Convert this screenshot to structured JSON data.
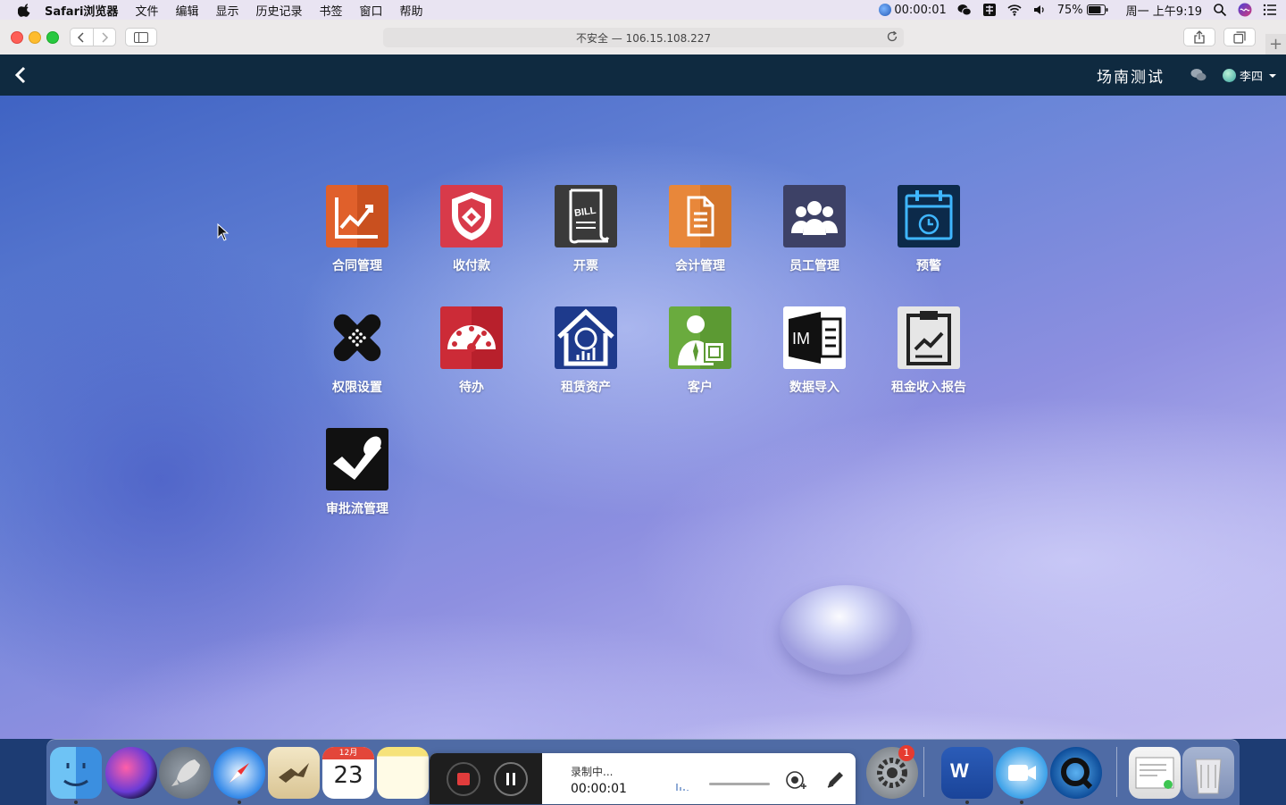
{
  "menubar": {
    "app_name": "Safari浏览器",
    "items": [
      "文件",
      "编辑",
      "显示",
      "历史记录",
      "书签",
      "窗口",
      "帮助"
    ],
    "record_time": "00:00:01",
    "battery": "75%",
    "datetime": "周一 上午9:19"
  },
  "browser": {
    "address": "不安全 — 106.15.108.227"
  },
  "app": {
    "title": "场南测试",
    "user_name": "李四"
  },
  "tiles": [
    {
      "label": "合同管理",
      "icon": "contract-chart-icon",
      "color": "#e0602b"
    },
    {
      "label": "收付款",
      "icon": "payment-shield-icon",
      "color": "#d83a4a"
    },
    {
      "label": "开票",
      "icon": "bill-receipt-icon",
      "color": "#3a3a3a"
    },
    {
      "label": "会计管理",
      "icon": "accounting-document-icon",
      "color": "#e8873a"
    },
    {
      "label": "员工管理",
      "icon": "staff-group-icon",
      "color": "#3d4166"
    },
    {
      "label": "预警",
      "icon": "alarm-calendar-icon",
      "color": "#0c2a4a"
    },
    {
      "label": "权限设置",
      "icon": "permission-bandage-icon",
      "color": "#111111"
    },
    {
      "label": "待办",
      "icon": "todo-gauge-icon",
      "color": "#cc2b37"
    },
    {
      "label": "租赁资产",
      "icon": "lease-house-icon",
      "color": "#1e3a8c"
    },
    {
      "label": "客户",
      "icon": "customer-person-icon",
      "color": "#6aab3e"
    },
    {
      "label": "数据导入",
      "icon": "data-import-im-icon",
      "color": "#ffffff"
    },
    {
      "label": "租金收入报告",
      "icon": "rent-report-clipboard-icon",
      "color": "#e6e6e6"
    },
    {
      "label": "审批流管理",
      "icon": "approval-stamp-icon",
      "color": "#111111"
    }
  ],
  "calendar_icon": {
    "month": "12月",
    "day": "23"
  },
  "word_icon_letter": "W",
  "dock_badge": "1",
  "recorder": {
    "status": "录制中...",
    "time": "00:00:01"
  }
}
